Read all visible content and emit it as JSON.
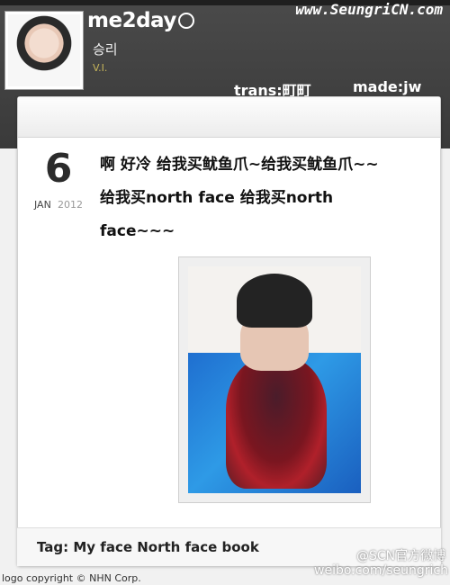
{
  "header": {
    "brand": "me2day",
    "username": "승리",
    "user_role": "V.I.",
    "watermark_url": "www.SeungriCN.com",
    "trans_credit": "trans:町町",
    "made_credit": "made:jw"
  },
  "post": {
    "day": "6",
    "month": "JAN",
    "year": "2012",
    "lines": [
      "啊 好冷 给我买鱿鱼爪~给我买鱿鱼爪~~",
      "给我买north face 给我买north",
      "face~~~"
    ],
    "tags": "Tag: My face North face book"
  },
  "footer": {
    "copyright": "logo copyright © NHN Corp.",
    "watermark_scn": "@SCN官方微博",
    "watermark_weibo": "weibo.com/seungrich"
  },
  "colors": {
    "topbar": "#3f3f3f",
    "accent_role": "#c6b45a",
    "jacket": "#2e9ae6",
    "scarf": "#7a1620"
  },
  "icons": {
    "brand_bubble": "speech-bubble-icon"
  }
}
